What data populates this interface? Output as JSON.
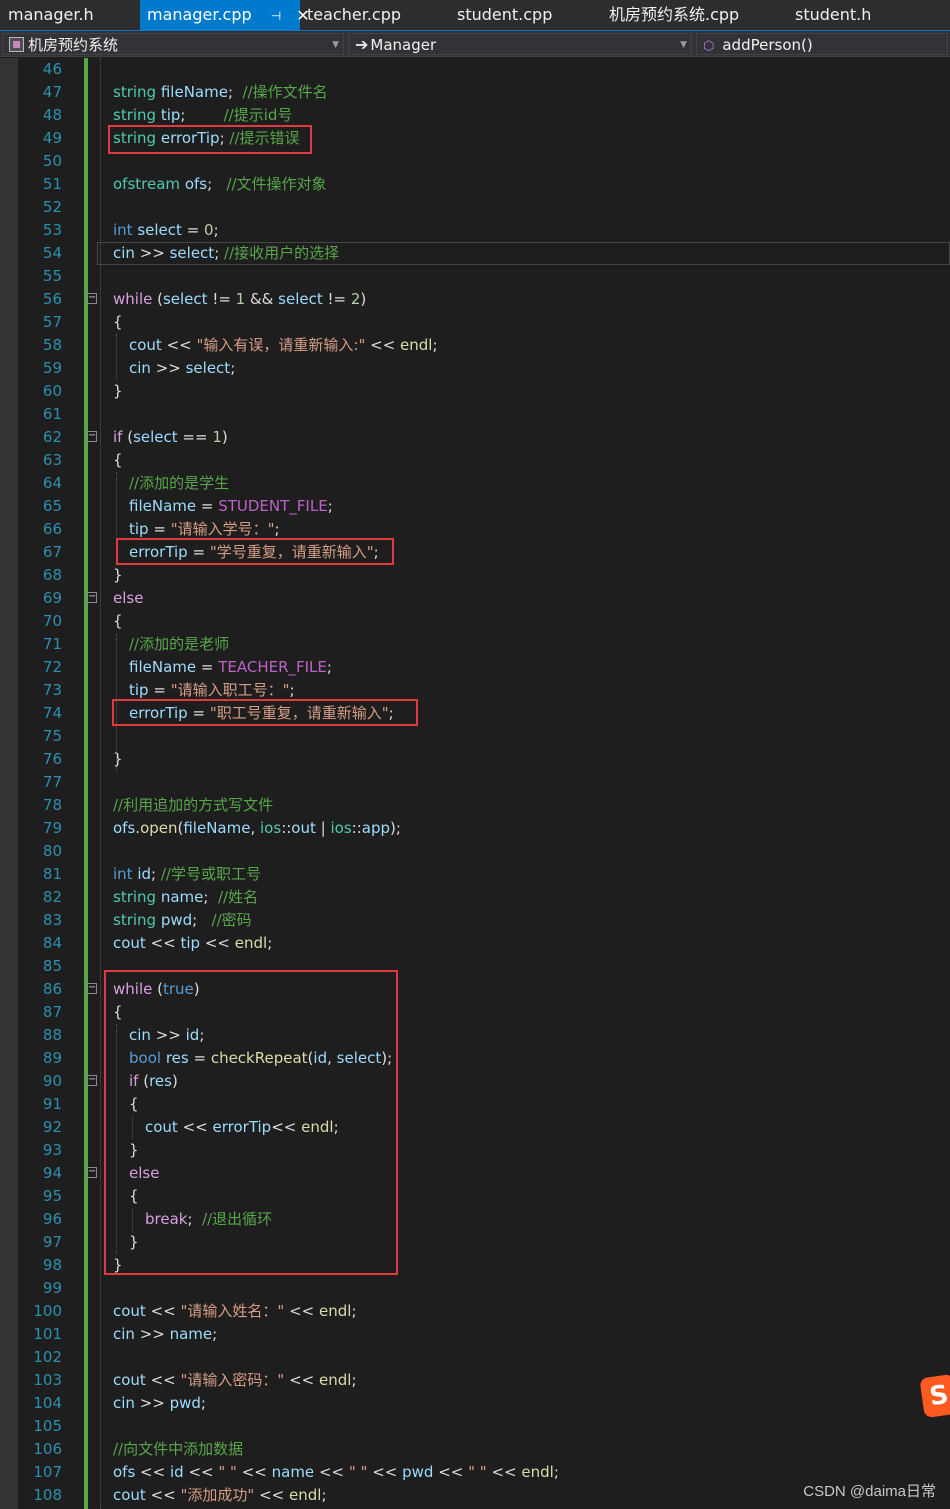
{
  "tabs": [
    {
      "label": "manager.h",
      "active": false
    },
    {
      "label": "manager.cpp",
      "active": true
    },
    {
      "label": "teacher.cpp",
      "active": false
    },
    {
      "label": "student.cpp",
      "active": false
    },
    {
      "label": "机房预约系统.cpp",
      "active": false
    },
    {
      "label": "student.h",
      "active": false
    }
  ],
  "navbar": {
    "project": "机房预约系统",
    "scope": "Manager",
    "member": "addPerson()"
  },
  "watermark": "CSDN @daima日常",
  "colors": {
    "accent": "#007acc",
    "highlight_box": "#e0393e",
    "line_number": "#2b91af",
    "comment": "#57a64a",
    "string": "#d69d85"
  },
  "lines": [
    {
      "n": "46",
      "indent": 0,
      "tokens": []
    },
    {
      "n": "47",
      "indent": 0,
      "tokens": [
        [
          "ty",
          "string"
        ],
        [
          "pl",
          " "
        ],
        [
          "var",
          "fileName"
        ],
        [
          "pl",
          ";  "
        ],
        [
          "cm",
          "//操作文件名"
        ]
      ]
    },
    {
      "n": "48",
      "indent": 0,
      "tokens": [
        [
          "ty",
          "string"
        ],
        [
          "pl",
          " "
        ],
        [
          "var",
          "tip"
        ],
        [
          "pl",
          ";        "
        ],
        [
          "cm",
          "//提示id号"
        ]
      ]
    },
    {
      "n": "49",
      "indent": 0,
      "tokens": [
        [
          "ty",
          "string"
        ],
        [
          "pl",
          " "
        ],
        [
          "var",
          "errorTip"
        ],
        [
          "pl",
          "; "
        ],
        [
          "cm",
          "//提示错误"
        ]
      ]
    },
    {
      "n": "50",
      "indent": 0,
      "tokens": []
    },
    {
      "n": "51",
      "indent": 0,
      "tokens": [
        [
          "ty",
          "ofstream"
        ],
        [
          "pl",
          " "
        ],
        [
          "var",
          "ofs"
        ],
        [
          "pl",
          ";   "
        ],
        [
          "cm",
          "//文件操作对象"
        ]
      ]
    },
    {
      "n": "52",
      "indent": 0,
      "tokens": []
    },
    {
      "n": "53",
      "indent": 0,
      "tokens": [
        [
          "kw",
          "int"
        ],
        [
          "pl",
          " "
        ],
        [
          "var",
          "select"
        ],
        [
          "pl",
          " = "
        ],
        [
          "num",
          "0"
        ],
        [
          "pl",
          ";"
        ]
      ]
    },
    {
      "n": "54",
      "indent": 0,
      "tokens": [
        [
          "var",
          "cin"
        ],
        [
          "pl",
          " >> "
        ],
        [
          "var",
          "select"
        ],
        [
          "pl",
          "; "
        ],
        [
          "cm",
          "//接收用户的选择"
        ]
      ]
    },
    {
      "n": "55",
      "indent": 0,
      "tokens": []
    },
    {
      "n": "56",
      "indent": 0,
      "fold": true,
      "tokens": [
        [
          "ctl",
          "while"
        ],
        [
          "pl",
          " ("
        ],
        [
          "var",
          "select"
        ],
        [
          "pl",
          " != "
        ],
        [
          "num",
          "1"
        ],
        [
          "pl",
          " && "
        ],
        [
          "var",
          "select"
        ],
        [
          "pl",
          " != "
        ],
        [
          "num",
          "2"
        ],
        [
          "pl",
          ")"
        ]
      ]
    },
    {
      "n": "57",
      "indent": 0,
      "tokens": [
        [
          "pl",
          "{"
        ]
      ]
    },
    {
      "n": "58",
      "indent": 1,
      "tokens": [
        [
          "var",
          "cout"
        ],
        [
          "pl",
          " << "
        ],
        [
          "st",
          "\"输入有误，请重新输入:\""
        ],
        [
          "pl",
          " << "
        ],
        [
          "fn",
          "endl"
        ],
        [
          "pl",
          ";"
        ]
      ]
    },
    {
      "n": "59",
      "indent": 1,
      "tokens": [
        [
          "var",
          "cin"
        ],
        [
          "pl",
          " >> "
        ],
        [
          "var",
          "select"
        ],
        [
          "pl",
          ";"
        ]
      ]
    },
    {
      "n": "60",
      "indent": 0,
      "tokens": [
        [
          "pl",
          "}"
        ]
      ]
    },
    {
      "n": "61",
      "indent": 0,
      "tokens": []
    },
    {
      "n": "62",
      "indent": 0,
      "fold": true,
      "tokens": [
        [
          "ctl",
          "if"
        ],
        [
          "pl",
          " ("
        ],
        [
          "var",
          "select"
        ],
        [
          "pl",
          " == "
        ],
        [
          "num",
          "1"
        ],
        [
          "pl",
          ")"
        ]
      ]
    },
    {
      "n": "63",
      "indent": 0,
      "tokens": [
        [
          "pl",
          "{"
        ]
      ]
    },
    {
      "n": "64",
      "indent": 1,
      "tokens": [
        [
          "cm",
          "//添加的是学生"
        ]
      ]
    },
    {
      "n": "65",
      "indent": 1,
      "tokens": [
        [
          "var",
          "fileName"
        ],
        [
          "pl",
          " = "
        ],
        [
          "mac",
          "STUDENT_FILE"
        ],
        [
          "pl",
          ";"
        ]
      ]
    },
    {
      "n": "66",
      "indent": 1,
      "tokens": [
        [
          "var",
          "tip"
        ],
        [
          "pl",
          " = "
        ],
        [
          "st",
          "\"请输入学号：\""
        ],
        [
          "pl",
          ";"
        ]
      ]
    },
    {
      "n": "67",
      "indent": 1,
      "tokens": [
        [
          "var",
          "errorTip"
        ],
        [
          "pl",
          " = "
        ],
        [
          "st",
          "\"学号重复，请重新输入\""
        ],
        [
          "pl",
          ";"
        ]
      ]
    },
    {
      "n": "68",
      "indent": 0,
      "tokens": [
        [
          "pl",
          "}"
        ]
      ]
    },
    {
      "n": "69",
      "indent": 0,
      "fold": true,
      "tokens": [
        [
          "ctl",
          "else"
        ]
      ]
    },
    {
      "n": "70",
      "indent": 0,
      "tokens": [
        [
          "pl",
          "{"
        ]
      ]
    },
    {
      "n": "71",
      "indent": 1,
      "tokens": [
        [
          "cm",
          "//添加的是老师"
        ]
      ]
    },
    {
      "n": "72",
      "indent": 1,
      "tokens": [
        [
          "var",
          "fileName"
        ],
        [
          "pl",
          " = "
        ],
        [
          "mac",
          "TEACHER_FILE"
        ],
        [
          "pl",
          ";"
        ]
      ]
    },
    {
      "n": "73",
      "indent": 1,
      "tokens": [
        [
          "var",
          "tip"
        ],
        [
          "pl",
          " = "
        ],
        [
          "st",
          "\"请输入职工号：\""
        ],
        [
          "pl",
          ";"
        ]
      ]
    },
    {
      "n": "74",
      "indent": 1,
      "tokens": [
        [
          "var",
          "errorTip"
        ],
        [
          "pl",
          " = "
        ],
        [
          "st",
          "\"职工号重复，请重新输入\""
        ],
        [
          "pl",
          ";"
        ]
      ]
    },
    {
      "n": "75",
      "indent": 0,
      "tokens": []
    },
    {
      "n": "76",
      "indent": 0,
      "tokens": [
        [
          "pl",
          "}"
        ]
      ]
    },
    {
      "n": "77",
      "indent": 0,
      "tokens": []
    },
    {
      "n": "78",
      "indent": 0,
      "tokens": [
        [
          "cm",
          "//利用追加的方式写文件"
        ]
      ]
    },
    {
      "n": "79",
      "indent": 0,
      "tokens": [
        [
          "var",
          "ofs"
        ],
        [
          "pl",
          "."
        ],
        [
          "fn",
          "open"
        ],
        [
          "pl",
          "("
        ],
        [
          "var",
          "fileName"
        ],
        [
          "pl",
          ", "
        ],
        [
          "ty",
          "ios"
        ],
        [
          "pl",
          "::"
        ],
        [
          "var",
          "out"
        ],
        [
          "pl",
          " | "
        ],
        [
          "ty",
          "ios"
        ],
        [
          "pl",
          "::"
        ],
        [
          "var",
          "app"
        ],
        [
          "pl",
          ");"
        ]
      ]
    },
    {
      "n": "80",
      "indent": 0,
      "tokens": []
    },
    {
      "n": "81",
      "indent": 0,
      "tokens": [
        [
          "kw",
          "int"
        ],
        [
          "pl",
          " "
        ],
        [
          "var",
          "id"
        ],
        [
          "pl",
          "; "
        ],
        [
          "cm",
          "//学号或职工号"
        ]
      ]
    },
    {
      "n": "82",
      "indent": 0,
      "tokens": [
        [
          "ty",
          "string"
        ],
        [
          "pl",
          " "
        ],
        [
          "var",
          "name"
        ],
        [
          "pl",
          ";  "
        ],
        [
          "cm",
          "//姓名"
        ]
      ]
    },
    {
      "n": "83",
      "indent": 0,
      "tokens": [
        [
          "ty",
          "string"
        ],
        [
          "pl",
          " "
        ],
        [
          "var",
          "pwd"
        ],
        [
          "pl",
          ";   "
        ],
        [
          "cm",
          "//密码"
        ]
      ]
    },
    {
      "n": "84",
      "indent": 0,
      "tokens": [
        [
          "var",
          "cout"
        ],
        [
          "pl",
          " << "
        ],
        [
          "var",
          "tip"
        ],
        [
          "pl",
          " << "
        ],
        [
          "fn",
          "endl"
        ],
        [
          "pl",
          ";"
        ]
      ]
    },
    {
      "n": "85",
      "indent": 0,
      "tokens": []
    },
    {
      "n": "86",
      "indent": 0,
      "fold": true,
      "tokens": [
        [
          "ctl",
          "while"
        ],
        [
          "pl",
          " ("
        ],
        [
          "kw",
          "true"
        ],
        [
          "pl",
          ")"
        ]
      ]
    },
    {
      "n": "87",
      "indent": 0,
      "tokens": [
        [
          "pl",
          "{"
        ]
      ]
    },
    {
      "n": "88",
      "indent": 1,
      "tokens": [
        [
          "var",
          "cin"
        ],
        [
          "pl",
          " >> "
        ],
        [
          "var",
          "id"
        ],
        [
          "pl",
          ";"
        ]
      ]
    },
    {
      "n": "89",
      "indent": 1,
      "tokens": [
        [
          "kw",
          "bool"
        ],
        [
          "pl",
          " "
        ],
        [
          "var",
          "res"
        ],
        [
          "pl",
          " = "
        ],
        [
          "fn",
          "checkRepeat"
        ],
        [
          "pl",
          "("
        ],
        [
          "var",
          "id"
        ],
        [
          "pl",
          ", "
        ],
        [
          "var",
          "select"
        ],
        [
          "pl",
          ");"
        ]
      ]
    },
    {
      "n": "90",
      "indent": 1,
      "fold": true,
      "tokens": [
        [
          "ctl",
          "if"
        ],
        [
          "pl",
          " ("
        ],
        [
          "var",
          "res"
        ],
        [
          "pl",
          ")"
        ]
      ]
    },
    {
      "n": "91",
      "indent": 1,
      "tokens": [
        [
          "pl",
          "{"
        ]
      ]
    },
    {
      "n": "92",
      "indent": 2,
      "tokens": [
        [
          "var",
          "cout"
        ],
        [
          "pl",
          " << "
        ],
        [
          "var",
          "errorTip"
        ],
        [
          "pl",
          "<< "
        ],
        [
          "fn",
          "endl"
        ],
        [
          "pl",
          ";"
        ]
      ]
    },
    {
      "n": "93",
      "indent": 1,
      "tokens": [
        [
          "pl",
          "}"
        ]
      ]
    },
    {
      "n": "94",
      "indent": 1,
      "fold": true,
      "tokens": [
        [
          "ctl",
          "else"
        ]
      ]
    },
    {
      "n": "95",
      "indent": 1,
      "tokens": [
        [
          "pl",
          "{"
        ]
      ]
    },
    {
      "n": "96",
      "indent": 2,
      "tokens": [
        [
          "ctl",
          "break"
        ],
        [
          "pl",
          ";  "
        ],
        [
          "cm",
          "//退出循环"
        ]
      ]
    },
    {
      "n": "97",
      "indent": 1,
      "tokens": [
        [
          "pl",
          "}"
        ]
      ]
    },
    {
      "n": "98",
      "indent": 0,
      "tokens": [
        [
          "pl",
          "}"
        ]
      ]
    },
    {
      "n": "99",
      "indent": 0,
      "tokens": []
    },
    {
      "n": "100",
      "indent": 0,
      "tokens": [
        [
          "var",
          "cout"
        ],
        [
          "pl",
          " << "
        ],
        [
          "st",
          "\"请输入姓名：\""
        ],
        [
          "pl",
          " << "
        ],
        [
          "fn",
          "endl"
        ],
        [
          "pl",
          ";"
        ]
      ]
    },
    {
      "n": "101",
      "indent": 0,
      "tokens": [
        [
          "var",
          "cin"
        ],
        [
          "pl",
          " >> "
        ],
        [
          "var",
          "name"
        ],
        [
          "pl",
          ";"
        ]
      ]
    },
    {
      "n": "102",
      "indent": 0,
      "tokens": []
    },
    {
      "n": "103",
      "indent": 0,
      "tokens": [
        [
          "var",
          "cout"
        ],
        [
          "pl",
          " << "
        ],
        [
          "st",
          "\"请输入密码：\""
        ],
        [
          "pl",
          " << "
        ],
        [
          "fn",
          "endl"
        ],
        [
          "pl",
          ";"
        ]
      ]
    },
    {
      "n": "104",
      "indent": 0,
      "tokens": [
        [
          "var",
          "cin"
        ],
        [
          "pl",
          " >> "
        ],
        [
          "var",
          "pwd"
        ],
        [
          "pl",
          ";"
        ]
      ]
    },
    {
      "n": "105",
      "indent": 0,
      "tokens": []
    },
    {
      "n": "106",
      "indent": 0,
      "tokens": [
        [
          "cm",
          "//向文件中添加数据"
        ]
      ]
    },
    {
      "n": "107",
      "indent": 0,
      "tokens": [
        [
          "var",
          "ofs"
        ],
        [
          "pl",
          " << "
        ],
        [
          "var",
          "id"
        ],
        [
          "pl",
          " << "
        ],
        [
          "st",
          "\" \""
        ],
        [
          "pl",
          " << "
        ],
        [
          "var",
          "name"
        ],
        [
          "pl",
          " << "
        ],
        [
          "st",
          "\" \""
        ],
        [
          "pl",
          " << "
        ],
        [
          "var",
          "pwd"
        ],
        [
          "pl",
          " << "
        ],
        [
          "st",
          "\" \""
        ],
        [
          "pl",
          " << "
        ],
        [
          "fn",
          "endl"
        ],
        [
          "pl",
          ";"
        ]
      ]
    },
    {
      "n": "108",
      "indent": 0,
      "tokens": [
        [
          "var",
          "cout"
        ],
        [
          "pl",
          " << "
        ],
        [
          "st",
          "\"添加成功\""
        ],
        [
          "pl",
          " << "
        ],
        [
          "fn",
          "endl"
        ],
        [
          "pl",
          ";"
        ]
      ]
    }
  ]
}
